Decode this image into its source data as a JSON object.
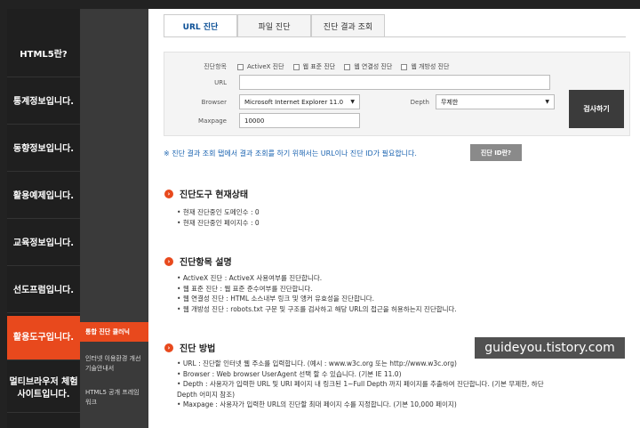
{
  "left_menu": [
    {
      "label": "HTML5란?",
      "active": false
    },
    {
      "label": "통계정보입니다.",
      "active": false
    },
    {
      "label": "동향정보입니다.",
      "active": false
    },
    {
      "label": "활용예제입니다.",
      "active": false
    },
    {
      "label": "교육정보입니다.",
      "active": false
    },
    {
      "label": "선도프럼입니다.",
      "active": false
    },
    {
      "label": "활용도구입니다.",
      "active": true
    },
    {
      "label": "멀티브라우저 체험 사이트입니다.",
      "active": false
    }
  ],
  "sub_menu": [
    {
      "label": "통합 진단 클러닉",
      "active": true
    },
    {
      "label": "인터넷 이용환경 개선 기술안내서",
      "active": false
    },
    {
      "label": "HTML5 공개 프레임워크",
      "active": false
    }
  ],
  "tabs": [
    {
      "label": "URL 진단",
      "active": true
    },
    {
      "label": "파일 진단",
      "active": false
    },
    {
      "label": "진단 결과 조회",
      "active": false
    }
  ],
  "form": {
    "items_label": "진단항목",
    "checkboxes": [
      "ActiveX 진단",
      "웹 표준 진단",
      "웹 연결성 진단",
      "웹 개방성 진단"
    ],
    "url_label": "URL",
    "url_value": "",
    "browser_label": "Browser",
    "browser_value": "Microsoft Internet Explorer 11.0",
    "depth_label": "Depth",
    "depth_value": "무제한",
    "maxpage_label": "Maxpage",
    "maxpage_value": "10000",
    "submit_label": "검사하기"
  },
  "notice": "※ 진단 결과 조회 탭에서 결과 조회를 하기 위해서는 URL이나 진단 ID가 필요합니다.",
  "id_button": "진단 ID란?",
  "sections": {
    "status": {
      "title": "진단도구 현재상태",
      "items": [
        "현재 진단중인 도메인수 : 0",
        "현재 진단중인 페이지수 : 0"
      ]
    },
    "items_desc": {
      "title": "진단항목 설명",
      "items": [
        "ActiveX 진단 : ActiveX 사용여부를 진단합니다.",
        "웹 표준 진단 : 웹 표준 준수여부를 진단합니다.",
        "웹 연결성 진단 : HTML 소스내부 링크 및 앵커 유효성을 진단합니다.",
        "웹 개방성 진단 : robots.txt 구문 및 구조를 검사하고 해당 URL의 접근을 허용하는지 진단합니다."
      ]
    },
    "method": {
      "title": "진단 방법",
      "items": [
        "URL : 진단할 인터넷 웹 주소를 입력합니다. (예시 : www.w3c.org 또는 http://www.w3c.org)",
        "Browser : Web browser UserAgent 선택 할 수 있습니다. (기본 IE 11.0)",
        "Depth : 사용자가 입력한 URL 및 URI 페이지 내 링크된 1~Full Depth 까지 페이지를 추출하여 진단합니다. (기본 무제한, 하단",
        "Depth 어미지 참조)",
        "Maxpage : 사용자가 입력한 URL의 진단할 최대 페이지 수를 지정합니다. (기본 10,000 페이지)"
      ]
    }
  },
  "watermark": "guideyou.tistory.com",
  "colors": {
    "accent": "#e8491d",
    "link": "#1a63b0",
    "tab_active": "#0b4f96"
  }
}
